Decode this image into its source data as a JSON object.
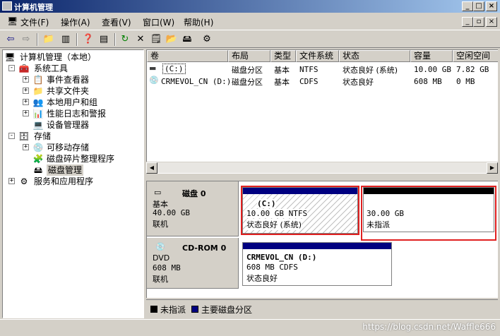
{
  "window": {
    "title": "计算机管理"
  },
  "menu": [
    "文件(F)",
    "操作(A)",
    "查看(V)",
    "窗口(W)",
    "帮助(H)"
  ],
  "tree": [
    {
      "label": "计算机管理（本地）",
      "level": 0,
      "icon": "computer-icon"
    },
    {
      "label": "系统工具",
      "level": 1,
      "icon": "tools-icon",
      "expander": "-"
    },
    {
      "label": "事件查看器",
      "level": 2,
      "icon": "event-viewer-icon",
      "expander": "+"
    },
    {
      "label": "共享文件夹",
      "level": 2,
      "icon": "shared-folder-icon",
      "expander": "+"
    },
    {
      "label": "本地用户和组",
      "level": 2,
      "icon": "users-icon",
      "expander": "+"
    },
    {
      "label": "性能日志和警报",
      "level": 2,
      "icon": "performance-icon",
      "expander": "+"
    },
    {
      "label": "设备管理器",
      "level": 2,
      "icon": "device-manager-icon",
      "expander": ""
    },
    {
      "label": "存储",
      "level": 1,
      "icon": "storage-icon",
      "expander": "-"
    },
    {
      "label": "可移动存储",
      "level": 2,
      "icon": "removable-storage-icon",
      "expander": "+"
    },
    {
      "label": "磁盘碎片整理程序",
      "level": 2,
      "icon": "defrag-icon",
      "expander": ""
    },
    {
      "label": "磁盘管理",
      "level": 2,
      "icon": "disk-management-icon",
      "expander": "",
      "selected": true
    },
    {
      "label": "服务和应用程序",
      "level": 1,
      "icon": "services-icon",
      "expander": "+"
    }
  ],
  "volumes": {
    "columns": [
      "卷",
      "布局",
      "类型",
      "文件系统",
      "状态",
      "容量",
      "空闲空间"
    ],
    "rows": [
      [
        "(C:)",
        "磁盘分区",
        "基本",
        "NTFS",
        "状态良好 (系统)",
        "10.00 GB",
        "7.82 GB"
      ],
      [
        "CRMEVOL_CN (D:)",
        "磁盘分区",
        "基本",
        "CDFS",
        "状态良好",
        "608 MB",
        "0 MB"
      ]
    ]
  },
  "disks": [
    {
      "name": "磁盘 0",
      "type": "基本",
      "size": "40.00 GB",
      "status": "联机",
      "partitions": [
        {
          "label": "(C:)",
          "detail": "10.00 GB NTFS",
          "status": "状态良好 (系统)",
          "color": "#000080"
        },
        {
          "label": "",
          "detail": "30.00 GB",
          "status": "未指派",
          "color": "#000000"
        }
      ]
    },
    {
      "name": "CD-ROM 0",
      "type": "DVD",
      "size": "608 MB",
      "status": "联机",
      "partitions": [
        {
          "label": "CRMEVOL_CN  (D:)",
          "detail": "608 MB CDFS",
          "status": "状态良好",
          "color": "#000080"
        }
      ]
    }
  ],
  "legend": [
    {
      "label": "未指派",
      "color": "#000000"
    },
    {
      "label": "主要磁盘分区",
      "color": "#000080"
    }
  ],
  "watermark": "https://blog.csdn.net/Waffle666"
}
